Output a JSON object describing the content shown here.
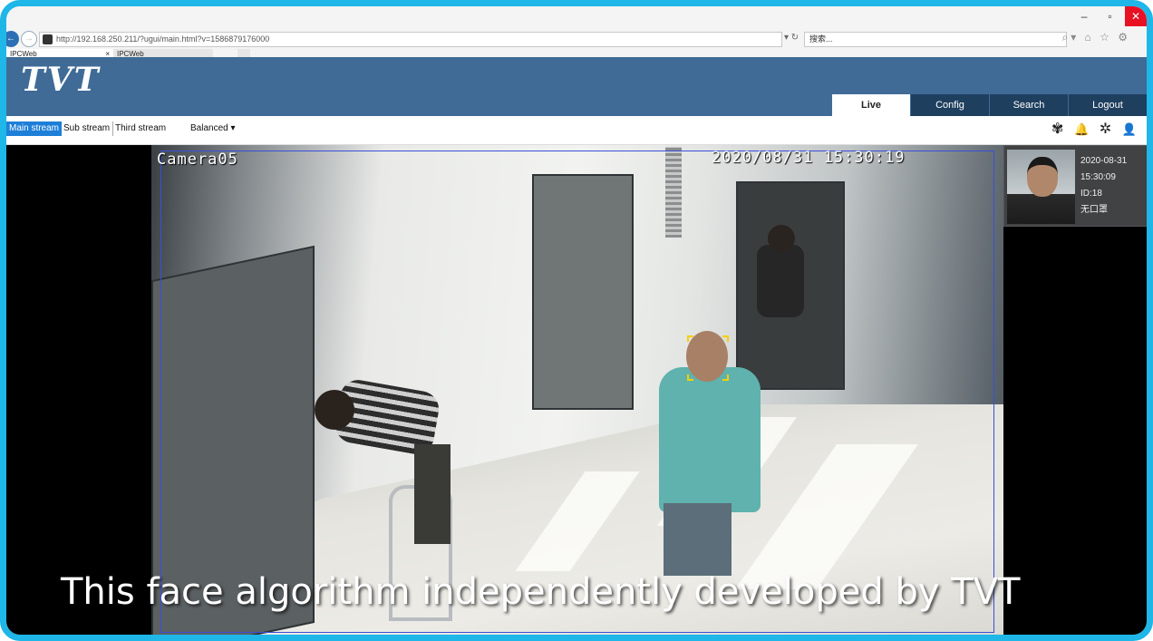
{
  "browser": {
    "url": "http://192.168.250.211/?ugui/main.html?v=1586879176000",
    "search_placeholder": "搜索...",
    "refresh_glyph": "▾ ↻",
    "tools_glyphs": "⌕▾ ⌂ ☆ ⚙",
    "tabs": [
      {
        "label": "IPCWeb"
      },
      {
        "label": "IPCWeb"
      }
    ],
    "win": {
      "minimize": "–",
      "maximize": "▫",
      "close": "✕"
    }
  },
  "app": {
    "logo": "TVT",
    "main_tabs": [
      {
        "label": "Live"
      },
      {
        "label": "Config"
      },
      {
        "label": "Search"
      },
      {
        "label": "Logout"
      }
    ],
    "active_tab": "Live"
  },
  "stream_bar": {
    "main": "Main stream",
    "sub": "Sub stream",
    "third": "Third stream",
    "balanced": "Balanced ▾",
    "icons": [
      "snapshot-icon",
      "alarm-bell-icon",
      "settings-grid-icon",
      "alarm-person-icon"
    ],
    "icon_glyphs": {
      "snapshot": "✾",
      "bell": "🔔",
      "grid": "✲",
      "person": "👤"
    }
  },
  "video": {
    "camera_name": "Camera05",
    "timestamp": "2020/08/31 15:30:19",
    "caption": "This face algorithm independently developed by TVT",
    "accent_roi": "#3a4fd8",
    "accent_face": "#f4d000"
  },
  "face_panel": {
    "date": "2020-08-31",
    "time": "15:30:09",
    "id": "ID:18",
    "mask": "无口罩"
  },
  "colors": {
    "frame": "#1fb6e8",
    "header": "#3f6b96",
    "tab_dark": "#1f3f5e",
    "stream_active": "#1e7fd8"
  }
}
